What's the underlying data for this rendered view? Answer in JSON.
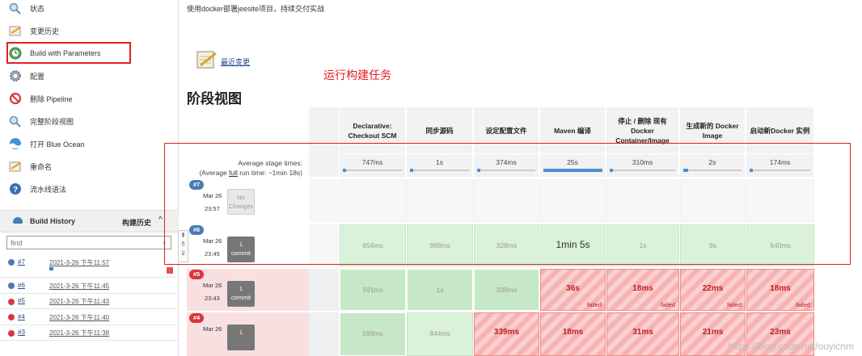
{
  "sidebar": {
    "items": [
      {
        "label": "状态",
        "icon": "magnifier-icon"
      },
      {
        "label": "变更历史",
        "icon": "notepad-icon"
      },
      {
        "label": "Build with Parameters",
        "icon": "build-clock-icon"
      },
      {
        "label": "配置",
        "icon": "gear-icon"
      },
      {
        "label": "删除 Pipeline",
        "icon": "no-entry-icon"
      },
      {
        "label": "完整阶段视图",
        "icon": "magnifier-icon"
      },
      {
        "label": "打开 Blue Ocean",
        "icon": "blue-ocean-icon"
      },
      {
        "label": "重命名",
        "icon": "notepad-icon"
      },
      {
        "label": "流水线语法",
        "icon": "help-icon"
      }
    ]
  },
  "build_history": {
    "title": "Build History",
    "title_cn": "构建历史",
    "caret": "^",
    "find_placeholder": "find",
    "find_clear": "x",
    "rows": [
      {
        "num": "#7",
        "date": "2021-3-26 下午11:57",
        "status_color": "#4a7bb5"
      },
      {
        "num": "#6",
        "date": "2021-3-26 下午11:45",
        "status_color": "#4a7bb5"
      },
      {
        "num": "#5",
        "date": "2021-3-26 下午11:43",
        "status_color": "#d9363e"
      },
      {
        "num": "#4",
        "date": "2021-3-26 下午11:40",
        "status_color": "#d9363e"
      },
      {
        "num": "#3",
        "date": "2021-3-26 下午11:38",
        "status_color": "#d9363e"
      }
    ]
  },
  "main": {
    "description": "使用docker部署jeesite项目，持续交付实战",
    "recent_changes": "最近变更",
    "annotation": "运行构建任务",
    "stage_view_title": "阶段视图",
    "avg_label_line1": "Average stage times:",
    "avg_label_line2_pre": "(Average ",
    "avg_label_line2_link": "full",
    "avg_label_line2_post": " run time: ~1min 18s)",
    "stages": [
      {
        "name": "Declarative: Checkout SCM",
        "avg": "747ms",
        "avg_fraction": 0.03
      },
      {
        "name": "同步源码",
        "avg": "1s",
        "avg_fraction": 0.05
      },
      {
        "name": "设定配置文件",
        "avg": "374ms",
        "avg_fraction": 0.02
      },
      {
        "name": "Maven 编译",
        "avg": "25s",
        "avg_fraction": 1.0
      },
      {
        "name": "停止 / 删除 现有 Docker Container/Image",
        "avg": "310ms",
        "avg_fraction": 0.02
      },
      {
        "name": "生成新的 Docker Image",
        "avg": "2s",
        "avg_fraction": 0.08
      },
      {
        "name": "启动新Docker 实例",
        "avg": "174ms",
        "avg_fraction": 0.01
      }
    ],
    "runs": [
      {
        "badge": "#7",
        "badge_color": "#4a7bb5",
        "date": "Mar 26",
        "time": "23:57",
        "changes": "No Changes",
        "commit_count": "",
        "commit_label": "",
        "bg": "#ffffff",
        "cells": []
      },
      {
        "badge": "#6",
        "badge_color": "#4a7bb5",
        "date": "Mar 26",
        "time": "23:45",
        "changes": "",
        "commit_count": "1",
        "commit_label": "commit",
        "bg": "#ffffff",
        "cells": [
          {
            "value": "654ms",
            "status": "ok"
          },
          {
            "value": "968ms",
            "status": "ok"
          },
          {
            "value": "328ms",
            "status": "ok"
          },
          {
            "value": "1min 5s",
            "status": "ok-big"
          },
          {
            "value": "1s",
            "status": "ok"
          },
          {
            "value": "9s",
            "status": "ok"
          },
          {
            "value": "640ms",
            "status": "ok"
          }
        ]
      },
      {
        "badge": "#5",
        "badge_color": "#d9363e",
        "date": "Mar 26",
        "time": "23:43",
        "changes": "",
        "commit_count": "1",
        "commit_label": "commit",
        "bg": "#f9e0e0",
        "cells": [
          {
            "value": "591ms",
            "status": "okdark"
          },
          {
            "value": "1s",
            "status": "okdark"
          },
          {
            "value": "339ms",
            "status": "okdark"
          },
          {
            "value": "36s",
            "status": "fail"
          },
          {
            "value": "18ms",
            "status": "fail"
          },
          {
            "value": "22ms",
            "status": "fail"
          },
          {
            "value": "18ms",
            "status": "fail"
          }
        ]
      },
      {
        "badge": "#4",
        "badge_color": "#d9363e",
        "date": "Mar 26",
        "time": "",
        "changes": "",
        "commit_count": "1",
        "commit_label": "",
        "bg": "#f9e0e0",
        "cells": [
          {
            "value": "599ms",
            "status": "okdark"
          },
          {
            "value": "844ms",
            "status": "ok"
          },
          {
            "value": "339ms",
            "status": "fail"
          },
          {
            "value": "18ms",
            "status": "fail"
          },
          {
            "value": "31ms",
            "status": "fail"
          },
          {
            "value": "21ms",
            "status": "fail"
          },
          {
            "value": "23ms",
            "status": "fail"
          }
        ]
      }
    ],
    "failed_label": "failed",
    "scroll_controls": [
      "⇞",
      "⇑",
      "⇓"
    ]
  },
  "watermark": "https://blog.csdn.net/ouyicnm",
  "colors": {
    "annotation_red": "#e02020",
    "success_blue": "#4a7bb5",
    "failure_red": "#d9363e"
  }
}
